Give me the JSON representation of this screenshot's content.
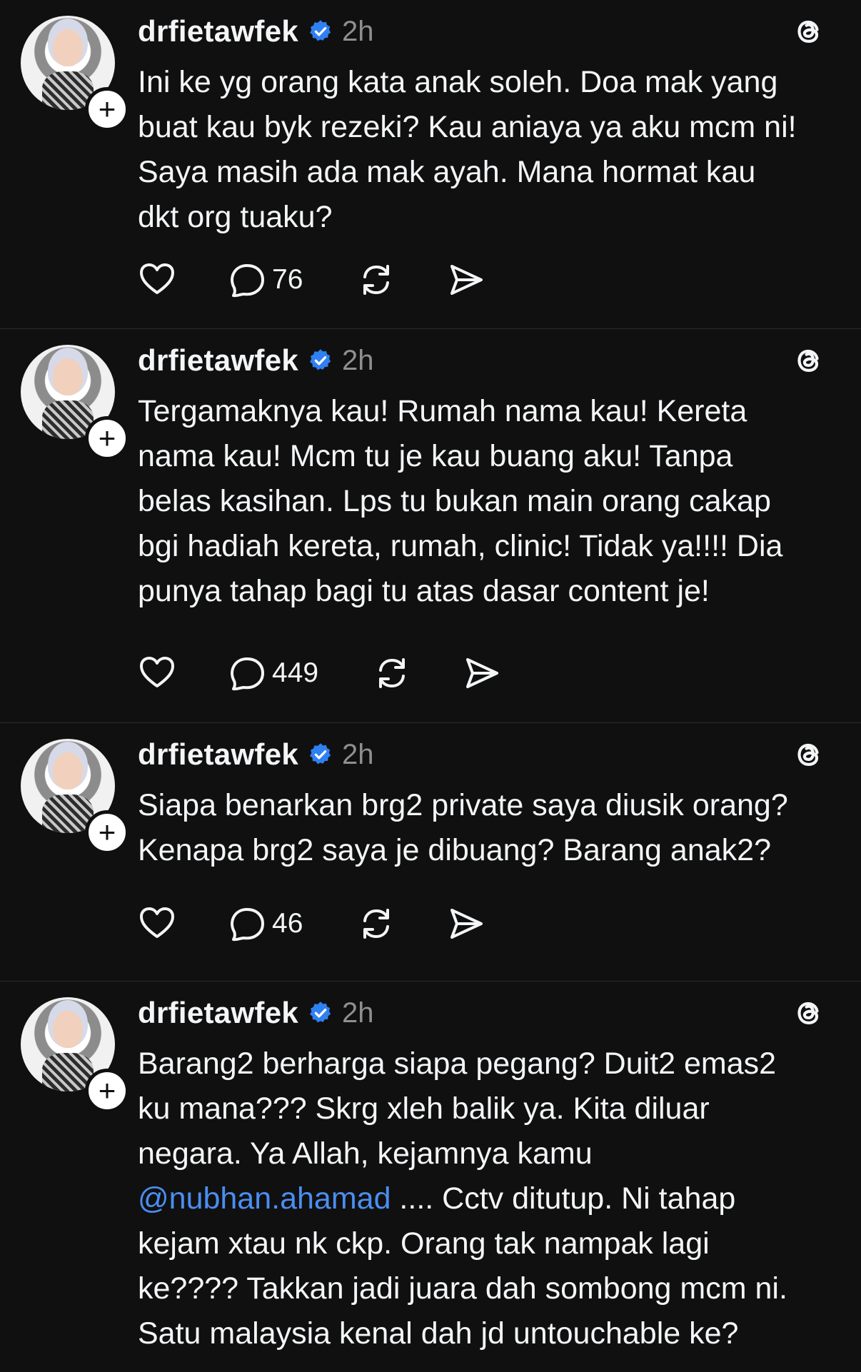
{
  "posts": [
    {
      "username": "drfietawfek",
      "time": "2h",
      "text": "Ini ke yg orang kata anak soleh. Doa mak yang\nbuat kau byk rezeki? Kau aniaya ya aku mcm ni!\nSaya masih ada mak ayah. Mana hormat kau\ndkt org tuaku?",
      "replies": "76"
    },
    {
      "username": "drfietawfek",
      "time": "2h",
      "text": "Tergamaknya kau! Rumah nama kau! Kereta\nnama kau! Mcm tu je kau buang aku! Tanpa\nbelas kasihan. Lps tu bukan main orang cakap\nbgi hadiah kereta, rumah, clinic! Tidak ya!!!! Dia\npunya tahap bagi tu atas dasar content je!",
      "replies": "449"
    },
    {
      "username": "drfietawfek",
      "time": "2h",
      "text": "Siapa benarkan brg2 private saya diusik orang?\nKenapa brg2 saya je dibuang? Barang anak2?",
      "replies": "46"
    },
    {
      "username": "drfietawfek",
      "time": "2h",
      "text_before": "Barang2 berharga siapa pegang? Duit2 emas2\nku mana??? Skrg xleh balik ya. Kita diluar\nnegara. Ya Allah, kejamnya kamu\n",
      "mention": "@nubhan.ahamad",
      "text_after": " .... Cctv ditutup. Ni tahap\nkejam xtau nk ckp. Orang tak nampak lagi\nke???? Takkan jadi juara dah sombong mcm ni.\nSatu malaysia kenal dah jd untouchable ke?"
    }
  ],
  "icons": {
    "verified": "verified-badge-icon",
    "threads": "threads-logo-icon",
    "like": "heart-icon",
    "reply": "comment-bubble-icon",
    "repost": "repost-icon",
    "share": "send-icon",
    "follow": "plus-icon"
  },
  "colors": {
    "background": "#101010",
    "text": "#f3f5f7",
    "muted": "#8f8f8f",
    "verified": "#2f80f1",
    "mention": "#4a8ef1"
  }
}
